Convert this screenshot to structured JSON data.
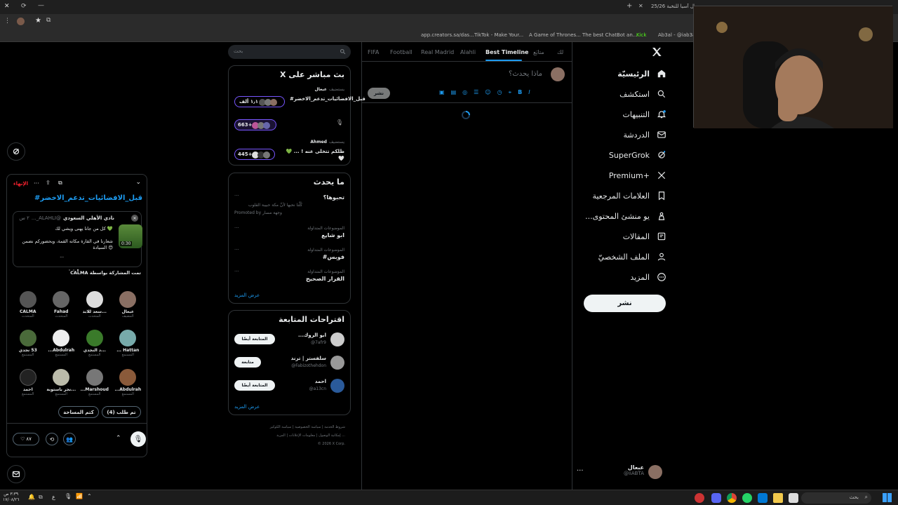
{
  "browser": {
    "tab_title": "25/26 نهائي أبطال آسيا للنخبة",
    "bookmarks": [
      "app.creators.sa/das...",
      "TikTok - Make Your...",
      "A Game of Thrones...",
      "The best ChatBot an...",
      "Kick",
      "Ab3al - @iab3al | C"
    ]
  },
  "nav": {
    "items": [
      {
        "label": "الرئيسيّة",
        "icon": "home-icon"
      },
      {
        "label": "استكشف",
        "icon": "search-icon"
      },
      {
        "label": "التنبيهات",
        "icon": "bell-icon"
      },
      {
        "label": "الدردشة",
        "icon": "mail-icon"
      },
      {
        "label": "SuperGrok",
        "icon": "grok-icon"
      },
      {
        "label": "Premium+",
        "icon": "x-icon"
      },
      {
        "label": "العلامات المرجعية",
        "icon": "bookmark-icon"
      },
      {
        "label": "...يو منشئ المحتوى",
        "icon": "creator-icon"
      },
      {
        "label": "المقالات",
        "icon": "articles-icon"
      },
      {
        "label": "الملف الشخصيّ",
        "icon": "profile-icon"
      },
      {
        "label": "المزيد",
        "icon": "more-icon"
      }
    ],
    "post_button": "نشر",
    "account_name": "عبعال",
    "account_handle": "@iiABTA"
  },
  "timeline": {
    "tabs": [
      "لك",
      "متابَع",
      "Best Timeline",
      "Alahli",
      "Real Madrid",
      "Football",
      "FIFA"
    ],
    "active_tab": "Best Timeline",
    "composer_placeholder": "ماذا يحدث؟",
    "composer_post_button": "نشر"
  },
  "search": {
    "placeholder": "بحث"
  },
  "live": {
    "title": "X بث مباشر على",
    "items": [
      {
        "host_prefix": "يستضيف",
        "host": "عبعال",
        "title": "#قبل_الافضائيات_تدعم_الاخضر",
        "count": "١٫١ ألف"
      },
      {
        "host_prefix": "",
        "host": "",
        "title": "",
        "count": "663+"
      },
      {
        "host_prefix": "يستضيف",
        "host": "Ahmed",
        "title": "💚 ... ! ظلكم تتخلى عنه 🤍",
        "count": "445+"
      }
    ]
  },
  "trends": {
    "title": "ما يحدث",
    "promo": {
      "title": "تحبوها؟",
      "desc": "كُلّنا نحبها لأنَّ مكة حبيبة القلوب",
      "promoted": "Promoted by وجهة مسار"
    },
    "items": [
      {
        "category": "الموضوعات المتداولة",
        "name": "ابو شايع"
      },
      {
        "category": "الموضوعات المتداولة",
        "name": "#فوبس"
      },
      {
        "category": "الموضوعات المتداولة",
        "name": "القرار الصحيح"
      }
    ],
    "show_more": "عرض المزيد"
  },
  "follow": {
    "title": "اقتراحات المتابعة",
    "items": [
      {
        "name": "...ابو الروك",
        "handle": "@7afr9",
        "button": "المتابعة أيضًا"
      },
      {
        "name": "سلفستر | ترند",
        "handle": "@Fabizothehdon",
        "button": "متابعة"
      },
      {
        "name": "احمد",
        "handle": "@a13cn",
        "button": "المتابعة أيضًا"
      }
    ],
    "show_more": "عرض المزيد"
  },
  "footer": {
    "links": [
      "شروط الخدمة",
      "سياسة الخصوصية",
      "سياسة الكوكيز",
      "إمكانية الوصول",
      "معلومات الإعلانات",
      "المزيد ..."
    ],
    "copyright": "© 2026 X Corp."
  },
  "space": {
    "end_label": "الإنهاء",
    "title": "#قبل_الافضائيات_تدعم_الاخضر",
    "pinned_author": "نادي الأهلي السعودي",
    "pinned_handle": "@ALAHLI_...",
    "pinned_time": "٢ س",
    "pinned_line1": "كل من جانا يهنى ويشي لك 💚",
    "pinned_line2": "شعارنا في القارة مكانه القمة، وبحضوركم نضمن السيادة 😍",
    "pinned_ellipsis": "...",
    "video_time": "0:30",
    "shared_by": "CALMA تمت المشاركة بواسطة",
    "speakers": [
      {
        "name": "عبعال",
        "role": "المضيف"
      },
      {
        "name": "...سعد للابد",
        "role": "المتحدث"
      },
      {
        "name": "Fahad",
        "role": "المتحدث"
      },
      {
        "name": "CALMA",
        "role": "المتحدث"
      },
      {
        "name": "Hattan ...",
        "role": "المستمع"
      },
      {
        "name": "...د النجدي",
        "role": "المستمع"
      },
      {
        "name": "Abdulrah...",
        "role": "المستمع"
      },
      {
        "name": "53 نجدي",
        "role": "المستمع"
      },
      {
        "name": "Abdulrah...",
        "role": "المستمع"
      },
      {
        "name": "Marshoud...",
        "role": "المستمع"
      },
      {
        "name": "...نجر باستوبة",
        "role": "المستمع"
      },
      {
        "name": "احمد",
        "role": "المستمع"
      }
    ],
    "request_button": "تم طلب (4)",
    "mute_button": "كتم المساحة",
    "reactions_count": "٨٧"
  },
  "taskbar": {
    "search_placeholder": "بحث",
    "clock_time": "٣:٣٩ ص",
    "clock_date": "١٧/٠٨/٢٦",
    "lang": "ع"
  },
  "colors": {
    "accent": "#1d9bf0",
    "end_red": "#f4212e",
    "space_purple": "#7856ff"
  }
}
